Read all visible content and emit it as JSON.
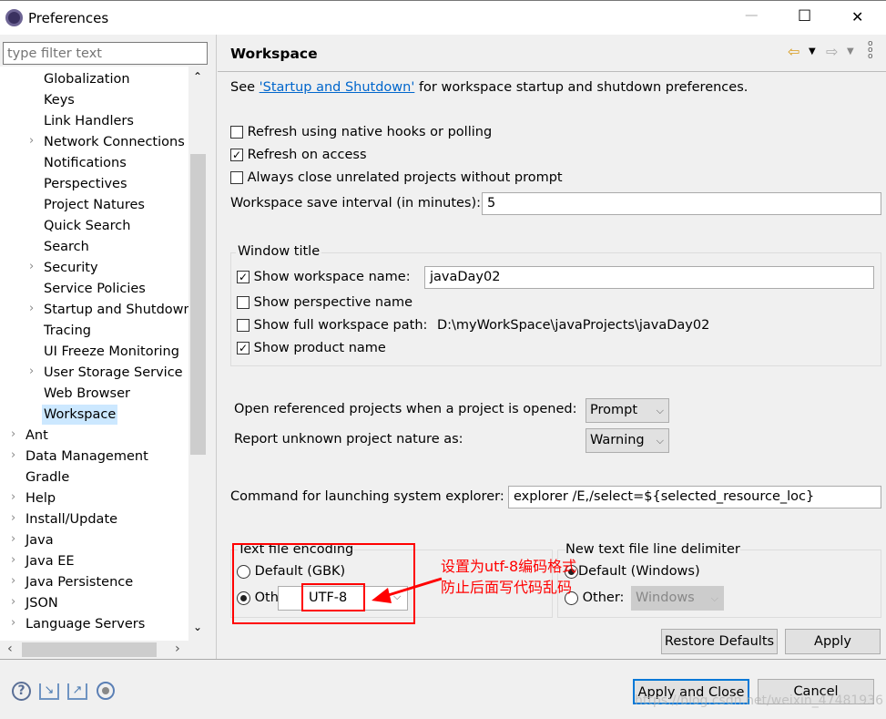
{
  "window": {
    "title": "Preferences",
    "minimize": "—",
    "maximize": "☐",
    "close": "✕"
  },
  "filter": {
    "placeholder": "type filter text"
  },
  "tree": [
    {
      "label": "Globalization",
      "arrow": false,
      "indent": 1
    },
    {
      "label": "Keys",
      "arrow": false,
      "indent": 1
    },
    {
      "label": "Link Handlers",
      "arrow": false,
      "indent": 1
    },
    {
      "label": "Network Connections",
      "arrow": true,
      "indent": 1
    },
    {
      "label": "Notifications",
      "arrow": false,
      "indent": 1
    },
    {
      "label": "Perspectives",
      "arrow": false,
      "indent": 1
    },
    {
      "label": "Project Natures",
      "arrow": false,
      "indent": 1
    },
    {
      "label": "Quick Search",
      "arrow": false,
      "indent": 1
    },
    {
      "label": "Search",
      "arrow": false,
      "indent": 1
    },
    {
      "label": "Security",
      "arrow": true,
      "indent": 1
    },
    {
      "label": "Service Policies",
      "arrow": false,
      "indent": 1
    },
    {
      "label": "Startup and Shutdown",
      "arrow": true,
      "indent": 1
    },
    {
      "label": "Tracing",
      "arrow": false,
      "indent": 1
    },
    {
      "label": "UI Freeze Monitoring",
      "arrow": false,
      "indent": 1
    },
    {
      "label": "User Storage Service",
      "arrow": true,
      "indent": 1
    },
    {
      "label": "Web Browser",
      "arrow": false,
      "indent": 1
    },
    {
      "label": "Workspace",
      "arrow": false,
      "indent": 1,
      "selected": true
    },
    {
      "label": "Ant",
      "arrow": true,
      "indent": 0
    },
    {
      "label": "Data Management",
      "arrow": true,
      "indent": 0
    },
    {
      "label": "Gradle",
      "arrow": false,
      "indent": 0
    },
    {
      "label": "Help",
      "arrow": true,
      "indent": 0
    },
    {
      "label": "Install/Update",
      "arrow": true,
      "indent": 0
    },
    {
      "label": "Java",
      "arrow": true,
      "indent": 0
    },
    {
      "label": "Java EE",
      "arrow": true,
      "indent": 0
    },
    {
      "label": "Java Persistence",
      "arrow": true,
      "indent": 0
    },
    {
      "label": "JSON",
      "arrow": true,
      "indent": 0
    },
    {
      "label": "Language Servers",
      "arrow": true,
      "indent": 0
    }
  ],
  "page": {
    "title": "Workspace",
    "see_prefix": "See ",
    "see_link": "'Startup and Shutdown'",
    "see_suffix": " for workspace startup and shutdown preferences.",
    "refresh_native": {
      "label": "Refresh using native hooks or polling",
      "checked": false
    },
    "refresh_access": {
      "label": "Refresh on access",
      "checked": true
    },
    "always_close": {
      "label": "Always close unrelated projects without prompt",
      "checked": false
    },
    "save_interval_label": "Workspace save interval (in minutes):",
    "save_interval_value": "5",
    "window_title": {
      "legend": "Window title",
      "show_ws_name": {
        "label": "Show workspace name:",
        "checked": true,
        "value": "javaDay02"
      },
      "show_perspective": {
        "label": "Show perspective name",
        "checked": false
      },
      "show_full_path": {
        "label": "Show full workspace path:",
        "checked": false,
        "value": "D:\\myWorkSpace\\javaProjects\\javaDay02"
      },
      "show_product": {
        "label": "Show product name",
        "checked": true
      }
    },
    "open_ref_label": "Open referenced projects when a project is opened:",
    "open_ref_value": "Prompt",
    "report_label": "Report unknown project nature as:",
    "report_value": "Warning",
    "cmd_label": "Command for launching system explorer:",
    "cmd_value": "explorer /E,/select=${selected_resource_loc}",
    "encoding": {
      "legend": "Text file encoding",
      "default_label": "Default (GBK)",
      "other_label": "Other:",
      "value": "UTF-8",
      "selected": "other"
    },
    "delimiter": {
      "legend": "New text file line delimiter",
      "default_label": "Default (Windows)",
      "other_label": "Other:",
      "value": "Windows",
      "selected": "default"
    },
    "restore_defaults": "Restore Defaults",
    "apply": "Apply"
  },
  "annotation": {
    "line1": "设置为utf-8编码格式",
    "line2": "防止后面写代码乱码",
    "color": "#ff0000"
  },
  "footer": {
    "apply_close": "Apply and Close",
    "cancel": "Cancel",
    "watermark": "https://blog.csdn.net/weixin_47481936"
  }
}
